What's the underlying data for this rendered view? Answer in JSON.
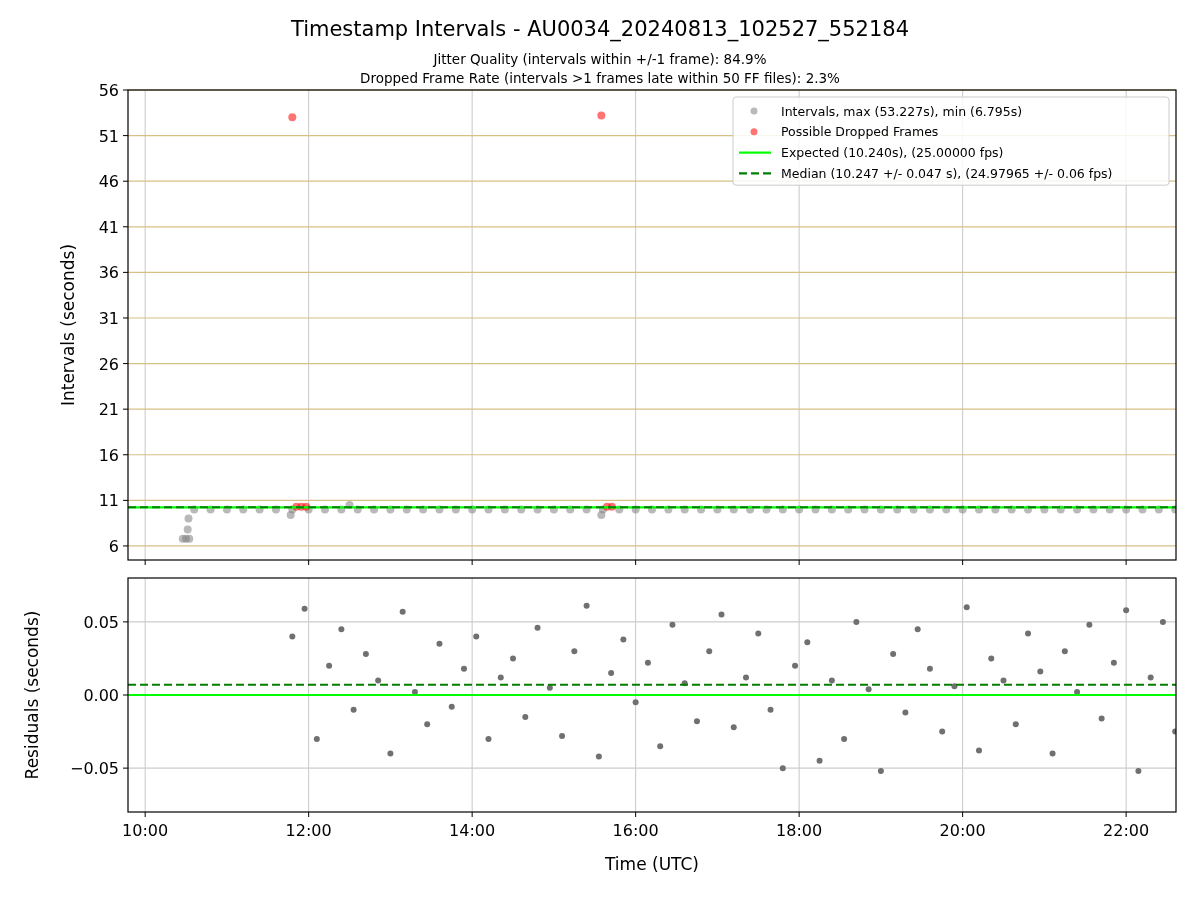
{
  "figure": {
    "title": "Timestamp Intervals - AU0034_20240813_102527_552184",
    "subtitles": [
      "Jitter Quality (intervals within +/-1 frame): 84.9%",
      "Dropped Frame Rate (intervals >1 frames late within 50 FF files): 2.3%"
    ]
  },
  "charts": [
    {
      "chart_data": {
        "type": "scatter",
        "grid": true,
        "legend": true,
        "ylabel": "Intervals (seconds)",
        "xlim": [
          9.79,
          22.61
        ],
        "ylim": [
          4.46,
          56
        ],
        "yticks": [
          {
            "value": 6,
            "label": "6"
          },
          {
            "value": 11,
            "label": "11"
          },
          {
            "value": 16,
            "label": "16"
          },
          {
            "value": 21,
            "label": "21"
          },
          {
            "value": 26,
            "label": "26"
          },
          {
            "value": 31,
            "label": "31"
          },
          {
            "value": 36,
            "label": "36"
          },
          {
            "value": 41,
            "label": "41"
          },
          {
            "value": 46,
            "label": "46"
          },
          {
            "value": 51,
            "label": "51"
          },
          {
            "value": 56,
            "label": "56"
          }
        ],
        "series": [
          {
            "name": "Intervals, max (53.227s), min (6.795s)",
            "color": "#808080",
            "x": [
              10.6,
              10.8,
              11.0,
              11.2,
              11.4,
              11.6,
              11.8,
              12.0,
              12.2,
              12.4,
              12.6,
              12.8,
              13.0,
              13.2,
              13.4,
              13.6,
              13.8,
              14.0,
              14.2,
              14.4,
              14.6,
              14.8,
              15.0,
              15.2,
              15.4,
              15.6,
              15.8,
              16.0,
              16.2,
              16.4,
              16.6,
              16.8,
              17.0,
              17.2,
              17.4,
              17.6,
              17.8,
              18.0,
              18.2,
              18.4,
              18.6,
              18.8,
              19.0,
              19.2,
              19.4,
              19.6,
              19.8,
              20.0,
              20.2,
              20.4,
              20.6,
              20.8,
              21.0,
              21.2,
              21.4,
              21.6,
              21.8,
              22.0,
              22.2,
              22.4,
              22.6,
              10.46,
              10.5,
              10.54,
              10.52,
              10.53,
              11.78,
              15.58,
              12.5
            ],
            "values": [
              10.0,
              10.0,
              10.0,
              10.0,
              10.0,
              10.0,
              10.0,
              10.0,
              10.0,
              10.0,
              10.0,
              10.0,
              10.0,
              10.0,
              10.0,
              10.0,
              10.0,
              10.0,
              10.0,
              10.0,
              10.0,
              10.0,
              10.0,
              10.0,
              10.0,
              10.0,
              10.0,
              10.0,
              10.0,
              10.0,
              10.0,
              10.0,
              10.0,
              10.0,
              10.0,
              10.0,
              10.0,
              10.0,
              10.0,
              10.0,
              10.0,
              10.0,
              10.0,
              10.0,
              10.0,
              10.0,
              10.0,
              10.0,
              10.0,
              10.0,
              10.0,
              10.0,
              10.0,
              10.0,
              10.0,
              10.0,
              10.0,
              10.0,
              10.0,
              10.0,
              10.0,
              6.8,
              6.8,
              6.8,
              7.8,
              9.0,
              9.4,
              9.4,
              10.5
            ]
          },
          {
            "name": "Possible Dropped Frames",
            "color": "#ff0000",
            "x": [
              11.8,
              15.58,
              11.85,
              11.91,
              11.97,
              15.65,
              15.71
            ],
            "values": [
              53.0,
              53.2,
              10.3,
              10.3,
              10.3,
              10.3,
              10.3
            ]
          },
          {
            "name": "Expected (10.240s), (25.00000 fps)",
            "type": "line",
            "line_style": "solid",
            "color": "#00ff00",
            "x": [
              9.79,
              22.61
            ],
            "values": [
              10.24,
              10.24
            ]
          },
          {
            "name": "Median (10.247 +/- 0.047 s), (24.97965 +/- 0.06 fps)",
            "type": "line",
            "line_style": "dashed",
            "color": "#008000",
            "x": [
              9.79,
              22.61
            ],
            "values": [
              10.247,
              10.247
            ]
          }
        ]
      }
    },
    {
      "chart_data": {
        "type": "scatter",
        "grid": true,
        "xlabel": "Time (UTC)",
        "ylabel": "Residuals (seconds)",
        "xlim": [
          9.79,
          22.61
        ],
        "ylim": [
          -0.08,
          0.08
        ],
        "xticks": [
          {
            "value": 10,
            "label": "10:00"
          },
          {
            "value": 12,
            "label": "12:00"
          },
          {
            "value": 14,
            "label": "14:00"
          },
          {
            "value": 16,
            "label": "16:00"
          },
          {
            "value": 18,
            "label": "18:00"
          },
          {
            "value": 20,
            "label": "20:00"
          },
          {
            "value": 22,
            "label": "22:00"
          }
        ],
        "yticks": [
          {
            "value": -0.05,
            "label": "−0.05"
          },
          {
            "value": 0,
            "label": "0.00"
          },
          {
            "value": 0.05,
            "label": "0.05"
          }
        ],
        "series": [
          {
            "color": "#707070",
            "x": [
              11.8,
              11.95,
              12.1,
              12.25,
              12.4,
              12.55,
              12.7,
              12.85,
              13,
              13.15,
              13.3,
              13.45,
              13.6,
              13.75,
              13.9,
              14.05,
              14.2,
              14.35,
              14.5,
              14.65,
              14.8,
              14.95,
              15.1,
              15.25,
              15.4,
              15.55,
              15.7,
              15.85,
              16,
              16.15,
              16.3,
              16.45,
              16.6,
              16.75,
              16.9,
              17.05,
              17.2,
              17.35,
              17.5,
              17.65,
              17.8,
              17.95,
              18.1,
              18.25,
              18.4,
              18.55,
              18.7,
              18.85,
              19,
              19.15,
              19.3,
              19.45,
              19.6,
              19.75,
              19.9,
              20.05,
              20.2,
              20.35,
              20.5,
              20.65,
              20.8,
              20.95,
              21.1,
              21.25,
              21.4,
              21.55,
              21.7,
              21.85,
              22,
              22.15,
              22.3,
              22.45,
              22.6
            ],
            "values": [
              0.04,
              0.059,
              -0.03,
              0.02,
              0.045,
              -0.01,
              0.028,
              0.01,
              -0.04,
              0.057,
              0.002,
              -0.02,
              0.035,
              -0.008,
              0.018,
              0.04,
              -0.03,
              0.012,
              0.025,
              -0.015,
              0.046,
              0.005,
              -0.028,
              0.03,
              0.061,
              -0.042,
              0.015,
              0.038,
              -0.005,
              0.022,
              -0.035,
              0.048,
              0.008,
              -0.018,
              0.03,
              0.055,
              -0.022,
              0.012,
              0.042,
              -0.01,
              -0.05,
              0.02,
              0.036,
              -0.045,
              0.01,
              -0.03,
              0.05,
              0.004,
              -0.052,
              0.028,
              -0.012,
              0.045,
              0.018,
              -0.025,
              0.006,
              0.06,
              -0.038,
              0.025,
              0.01,
              -0.02,
              0.042,
              0.016,
              -0.04,
              0.03,
              0.002,
              0.048,
              -0.016,
              0.022,
              0.058,
              -0.052,
              0.012,
              0.05,
              -0.025
            ]
          },
          {
            "type": "line",
            "line_style": "solid",
            "color": "#00ff00",
            "x": [
              9.79,
              22.61
            ],
            "values": [
              0,
              0
            ]
          },
          {
            "type": "line",
            "line_style": "dashed",
            "color": "#008000",
            "x": [
              9.79,
              22.61
            ],
            "values": [
              0.007,
              0.007
            ]
          }
        ]
      }
    }
  ]
}
